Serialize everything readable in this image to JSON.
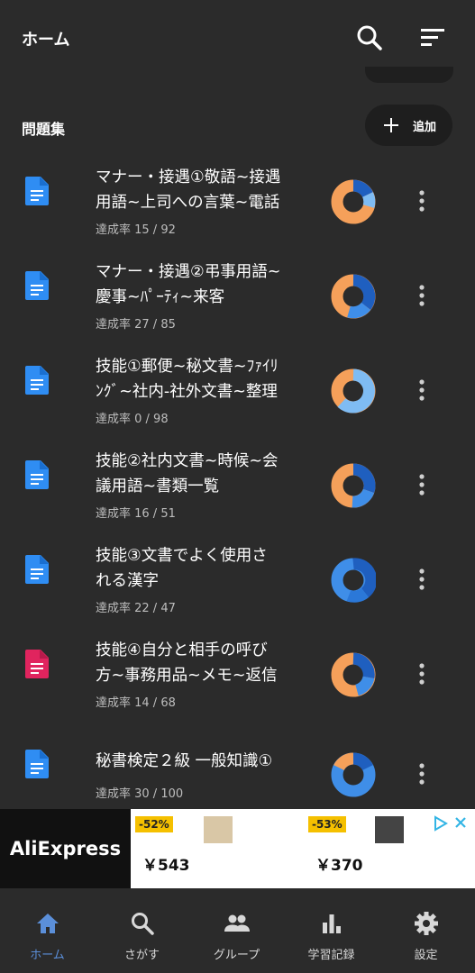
{
  "app_bar": {
    "title": "ホーム",
    "search_icon": "search-icon",
    "sort_icon": "sort-icon"
  },
  "section": {
    "title": "問題集",
    "add_label": "追加"
  },
  "items": [
    {
      "line1": "マナー・接遇①敬語~接遇",
      "line2": "用語~上司への言葉~電話",
      "progress": "達成率 15 / 92",
      "icon_color": "#2f8df3"
    },
    {
      "line1": "マナー・接遇②弔事用語~",
      "line2": "慶事~ﾊﾟｰﾃｨ~来客",
      "progress": "達成率 27 / 85",
      "icon_color": "#2f8df3"
    },
    {
      "line1": "技能①郵便~秘文書~ﾌｧｲﾘ",
      "line2": "ﾝｸﾞ~社内-社外文書~整理",
      "progress": "達成率 0 / 98",
      "icon_color": "#2f8df3"
    },
    {
      "line1": "技能②社内文書~時候~会",
      "line2": "議用語~書類一覧",
      "progress": "達成率 16 / 51",
      "icon_color": "#2f8df3"
    },
    {
      "line1": "技能③文書でよく使用さ",
      "line2": "れる漢字",
      "progress": "達成率 22 / 47",
      "icon_color": "#2f8df3"
    },
    {
      "line1": "技能④自分と相手の呼び",
      "line2": "方~事務用品~メモ~返信",
      "progress": "達成率 14 / 68",
      "icon_color": "#e0245e"
    },
    {
      "line1": "秘書検定２級 一般知識①",
      "line2": "",
      "progress": "達成率 30 / 100",
      "icon_color": "#2f8df3"
    }
  ],
  "ad": {
    "brand": "AliExpress",
    "deals": [
      {
        "discount": "-52%",
        "price": "￥543"
      },
      {
        "discount": "-53%",
        "price": "￥370"
      }
    ]
  },
  "nav": [
    {
      "label": "ホーム",
      "icon": "home-icon",
      "active": true
    },
    {
      "label": "さがす",
      "icon": "search-icon"
    },
    {
      "label": "グループ",
      "icon": "group-icon"
    },
    {
      "label": "学習記録",
      "icon": "bar-chart-icon"
    },
    {
      "label": "設定",
      "icon": "gear-icon"
    }
  ],
  "colors": {
    "orange": "#f5a05a",
    "dark_blue": "#1f5fbf",
    "blue": "#3f8ee8",
    "light_blue": "#7fbcf3",
    "active_nav": "#5b8fd9"
  }
}
